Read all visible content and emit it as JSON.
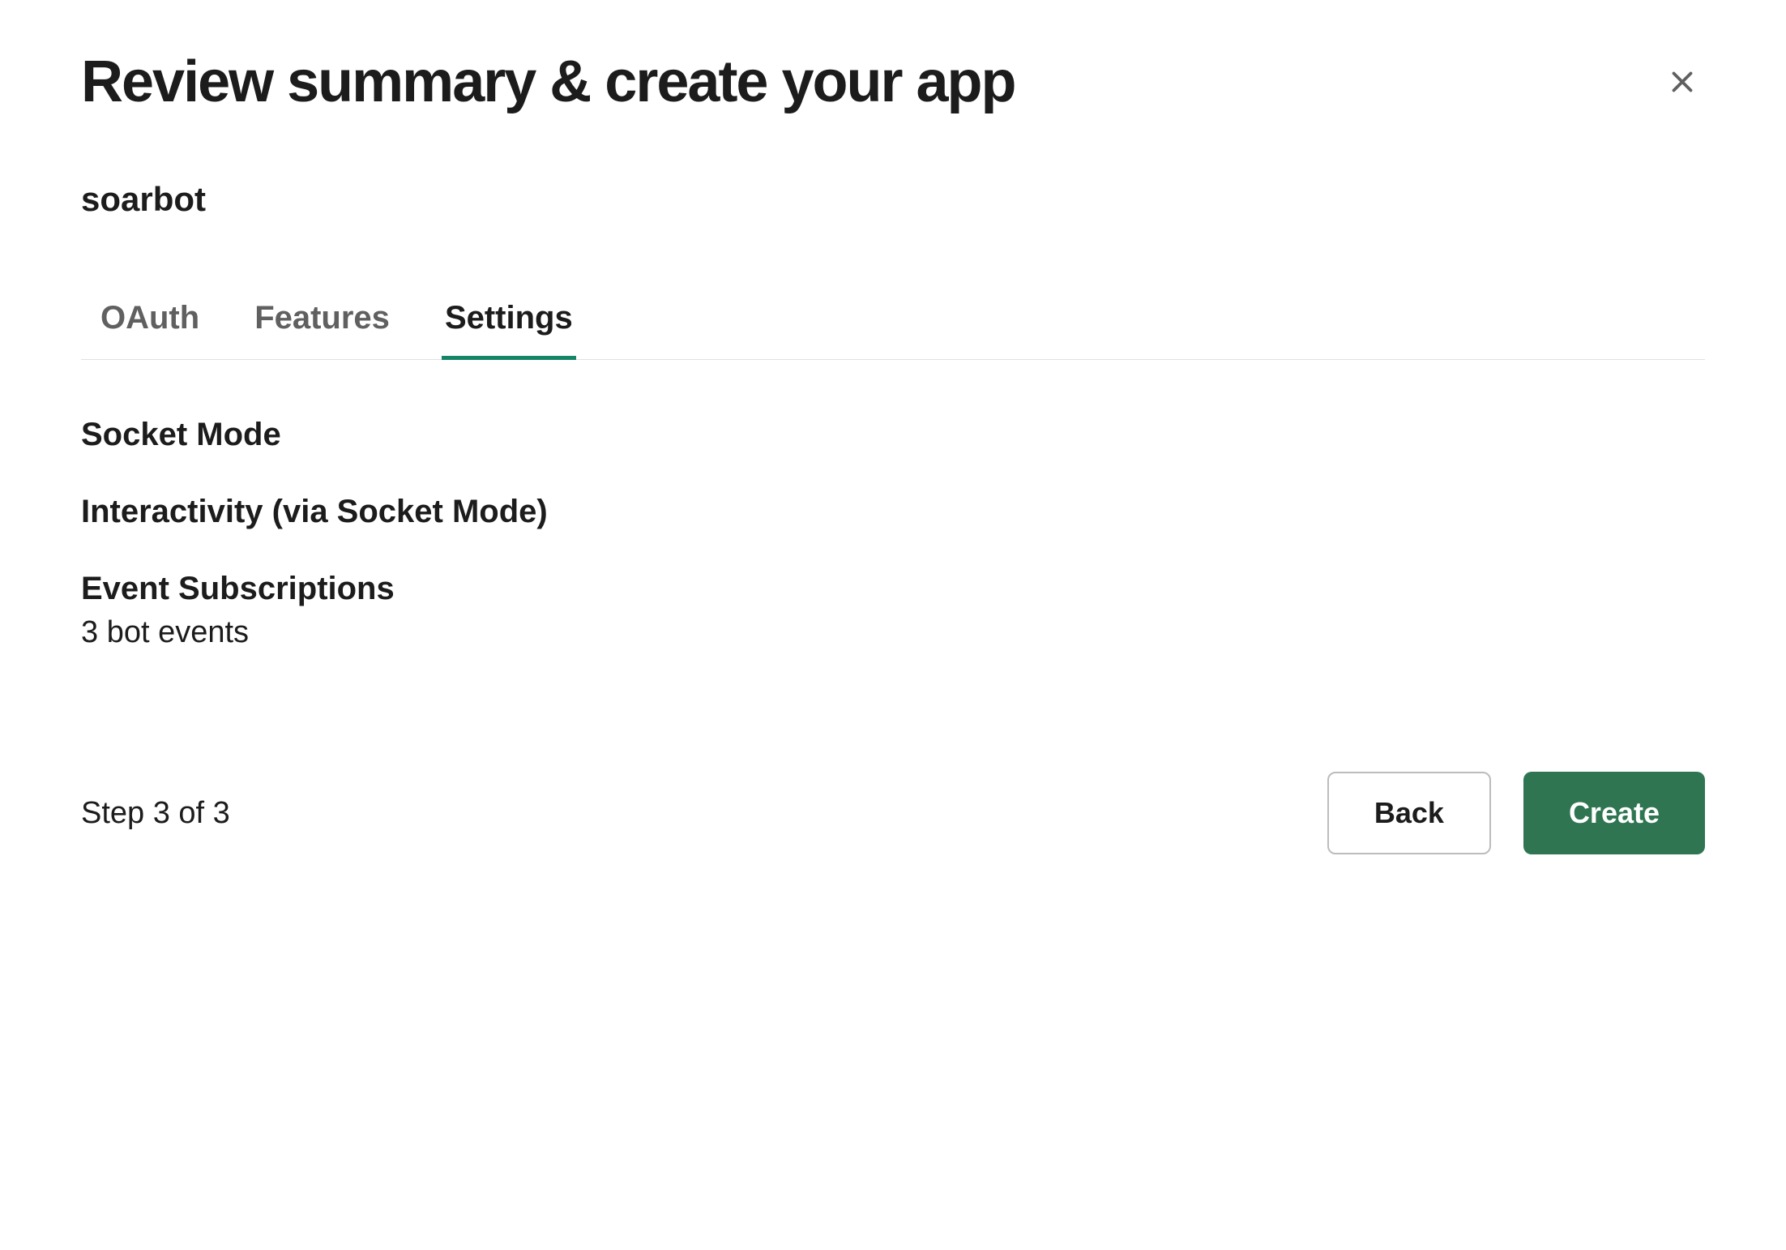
{
  "header": {
    "title": "Review summary & create your app"
  },
  "app": {
    "name": "soarbot"
  },
  "tabs": {
    "items": [
      {
        "label": "OAuth",
        "active": false
      },
      {
        "label": "Features",
        "active": false
      },
      {
        "label": "Settings",
        "active": true
      }
    ]
  },
  "settings": {
    "socket_mode": "Socket Mode",
    "interactivity": "Interactivity (via Socket Mode)",
    "event_subscriptions_title": "Event Subscriptions",
    "event_subscriptions_detail": "3 bot events"
  },
  "footer": {
    "step": "Step 3 of 3",
    "back_label": "Back",
    "create_label": "Create"
  },
  "colors": {
    "accent": "#148567",
    "create_button": "#2f7552"
  }
}
